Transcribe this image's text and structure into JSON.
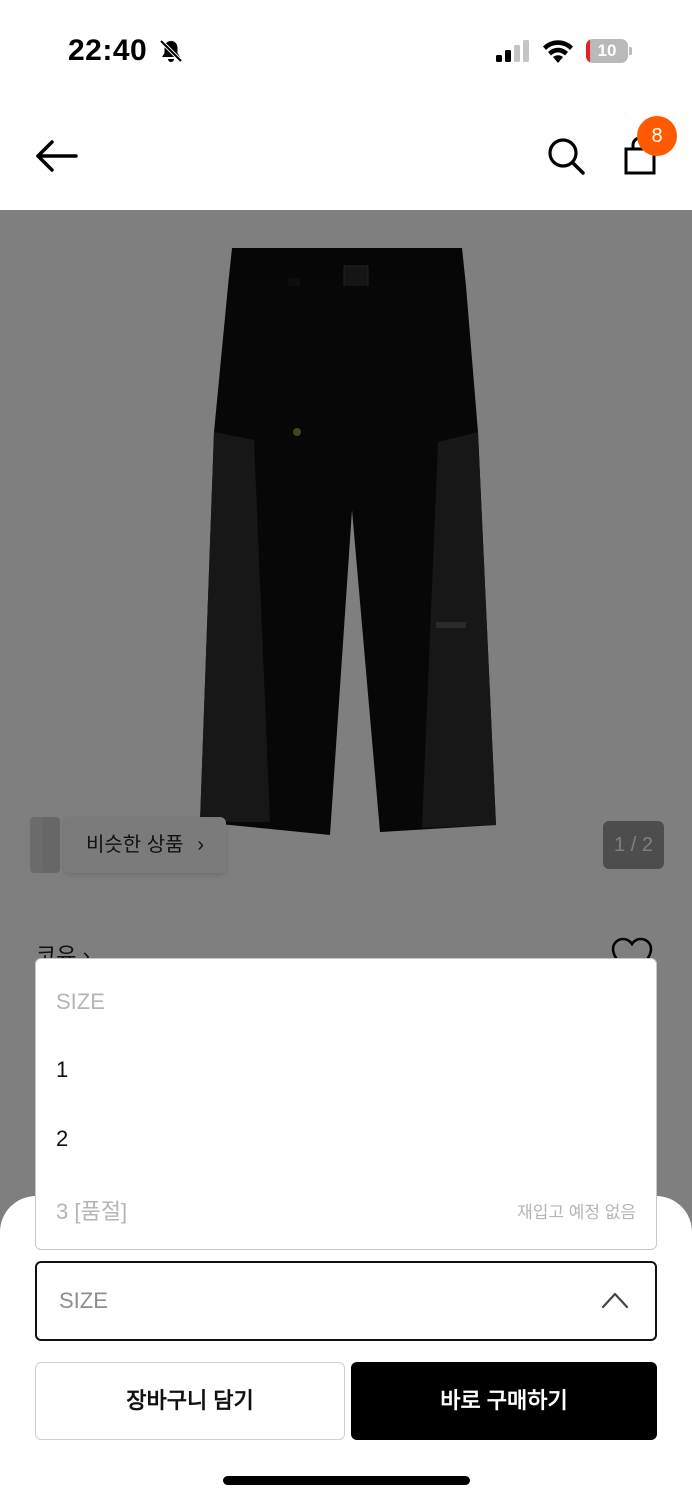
{
  "status_bar": {
    "time": "22:40",
    "battery_percent": "10",
    "icons": [
      "bell-slash-icon",
      "signal-icon",
      "wifi-icon",
      "battery-charging-icon"
    ],
    "battery_color": "#e0202a"
  },
  "top_nav": {
    "icons": [
      "arrow-left-icon",
      "search-icon",
      "shopping-bag-icon"
    ],
    "cart_count": "8",
    "badge_color": "#ff5a00"
  },
  "product": {
    "similar_label": "비슷한 상품",
    "similar_chevron": "›",
    "page_indicator": "1 / 2",
    "brand": "코유 ›"
  },
  "dropdown": {
    "header": "SIZE",
    "options": [
      {
        "label": "1",
        "note": ""
      },
      {
        "label": "2",
        "note": ""
      },
      {
        "label": "3 [품절]",
        "note": "재입고 예정 없음"
      }
    ]
  },
  "size_select": {
    "label": "SIZE"
  },
  "actions": {
    "cart_label": "장바구니 담기",
    "buy_label": "바로 구매하기"
  }
}
